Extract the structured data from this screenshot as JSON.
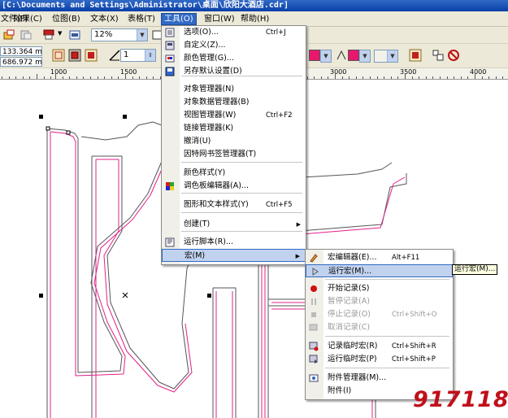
{
  "titlebar": {
    "title": "[C:\\Documents and Settings\\Administrator\\桌面\\欣阳大酒店.cdr]"
  },
  "menubar": [
    {
      "label": "文件(F)"
    },
    {
      "label": "效果(C)"
    },
    {
      "label": "位图(B)"
    },
    {
      "label": "文本(X)"
    },
    {
      "label": "表格(T)"
    },
    {
      "label": "工具(O)"
    },
    {
      "label": "窗口(W)"
    },
    {
      "label": "帮助(H)"
    }
  ],
  "toolbar": {
    "zoom": "12%",
    "coord_x": "133.364 mm",
    "coord_y": "686.972 mm",
    "outline_width": "1"
  },
  "ruler": {
    "labels": [
      "1000",
      "1500",
      "3000",
      "3500",
      "4000"
    ]
  },
  "tools_menu": {
    "items": [
      {
        "label": "选项(O)...",
        "shortcut": "Ctrl+J",
        "icon": "options-icon"
      },
      {
        "label": "自定义(Z)...",
        "shortcut": "",
        "icon": "customize-icon"
      },
      {
        "label": "颜色管理(G)...",
        "shortcut": "",
        "icon": "color-management-icon"
      },
      {
        "label": "另存默认设置(D)",
        "shortcut": "",
        "icon": "save-defaults-icon"
      },
      {
        "label": "对象管理器(N)",
        "shortcut": ""
      },
      {
        "label": "对象数据管理器(B)",
        "shortcut": ""
      },
      {
        "label": "视图管理器(W)",
        "shortcut": "Ctrl+F2"
      },
      {
        "label": "链接管理器(K)",
        "shortcut": ""
      },
      {
        "label": "撤消(U)",
        "shortcut": ""
      },
      {
        "label": "因特网书签管理器(T)",
        "shortcut": ""
      },
      {
        "label": "颜色样式(Y)",
        "shortcut": ""
      },
      {
        "label": "调色板编辑器(A)...",
        "shortcut": "",
        "icon": "palette-editor-icon"
      },
      {
        "label": "图形和文本样式(Y)",
        "shortcut": "Ctrl+F5"
      },
      {
        "label": "创建(T)",
        "shortcut": "",
        "submenu": true
      },
      {
        "label": "运行脚本(R)...",
        "shortcut": "",
        "icon": "run-script-icon"
      },
      {
        "label": "宏(M)",
        "shortcut": "",
        "submenu": true
      }
    ]
  },
  "macro_menu": {
    "items": [
      {
        "label": "宏编辑器(E)...",
        "shortcut": "Alt+F11",
        "icon": "macro-editor-icon"
      },
      {
        "label": "运行宏(M)...",
        "shortcut": "",
        "icon": "run-macro-icon"
      },
      {
        "label": "开始记录(S)",
        "shortcut": "",
        "icon": "record-icon"
      },
      {
        "label": "暂停记录(A)",
        "shortcut": "",
        "icon": "pause-icon"
      },
      {
        "label": "停止记录(O)",
        "shortcut": "Ctrl+Shift+O",
        "icon": "stop-icon"
      },
      {
        "label": "取消记录(C)",
        "shortcut": "",
        "icon": "cancel-record-icon"
      },
      {
        "label": "记录临时宏(R)",
        "shortcut": "Ctrl+Shift+R",
        "icon": "record-temp-icon"
      },
      {
        "label": "运行临时宏(P)",
        "shortcut": "Ctrl+Shift+P",
        "icon": "run-temp-icon"
      },
      {
        "label": "附件管理器(M)...",
        "shortcut": "",
        "icon": "addon-manager-icon"
      },
      {
        "label": "附件(I)",
        "shortcut": ""
      }
    ]
  },
  "tooltip": {
    "text": "运行宏(M)..."
  },
  "watermark": {
    "text": "917118"
  },
  "colors": {
    "menu_highlight": "#c1d2ee",
    "magenta_swatch": "#e8186e",
    "outline_pink": "#e0208a"
  }
}
